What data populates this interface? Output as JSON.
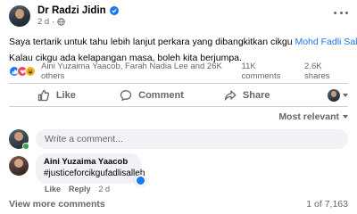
{
  "post": {
    "author": "Dr Radzi Jidin",
    "time": "2 d",
    "paragraph1_prefix": "Saya tertarik untuk tahu lebih lanjut perkara yang dibangkitkan cikgu ",
    "paragraph1_mention": "Mohd Fadli Salleh",
    "paragraph1_suffix": ".",
    "paragraph2": "Kalau cikgu ada kelapangan masa, boleh kita berjumpa."
  },
  "reactions": {
    "names": "Aini Yuzaima Yaacob, Farah Nadia Lee and 26K others",
    "comments_count": "11K comments",
    "shares_count": "2.6K shares"
  },
  "actions": {
    "like_label": "Like",
    "comment_label": "Comment",
    "share_label": "Share"
  },
  "sort": {
    "label": "Most relevant"
  },
  "composer": {
    "placeholder": "Write a comment..."
  },
  "comment": {
    "author": "Aini Yuzaima Yaacob",
    "text": "#justiceforcikgufadlisalleh",
    "like_label": "Like",
    "reply_label": "Reply",
    "time": "2 d"
  },
  "footer": {
    "view_more": "View more comments",
    "pagination": "1 of 7,163"
  },
  "colors": {
    "accent": "#1b74e4",
    "like_blue": "#1877f2",
    "love_red": "#f33e58",
    "haha_yellow": "#f7b125",
    "online_green": "#31a24c",
    "secondary_text": "#65676b"
  }
}
